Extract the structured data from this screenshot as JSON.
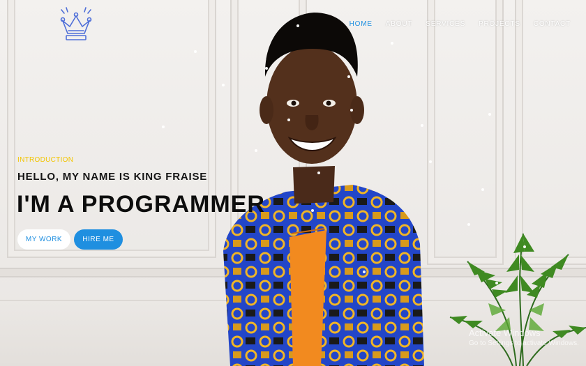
{
  "nav": {
    "items": [
      {
        "label": "HOME",
        "active": true
      },
      {
        "label": "ABOUT",
        "active": false
      },
      {
        "label": "SERVICES",
        "active": false
      },
      {
        "label": "PROJECTS",
        "active": false
      },
      {
        "label": "CONTACT",
        "active": false
      }
    ]
  },
  "logo": {
    "icon": "crown-icon"
  },
  "hero": {
    "intro": "INTRODUCTION",
    "hello": "HELLO, MY NAME IS KING FRAISE",
    "role": "I'M A PROGRAMMER",
    "btn_work": "MY WORK",
    "btn_hire": "HIRE ME"
  },
  "watermark": {
    "line1": "Activate Windows",
    "line2": "Go to Settings to activate Windows."
  },
  "colors": {
    "accent": "#1f8fe0",
    "intro": "#f2c500",
    "heading": "#0d0d0d",
    "wall": "#ece9e6"
  }
}
